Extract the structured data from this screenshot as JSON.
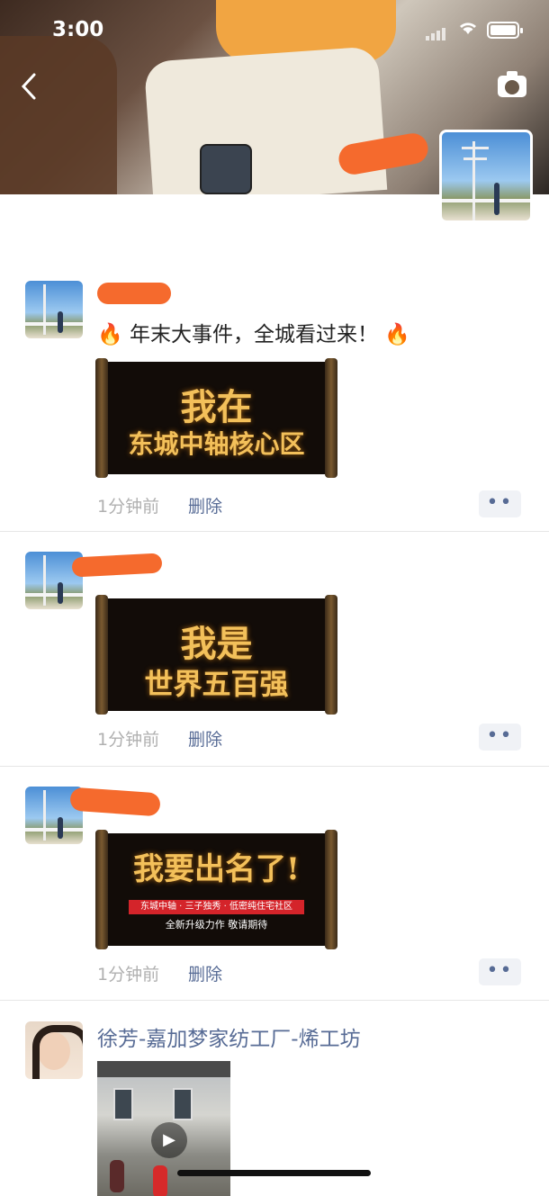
{
  "status_bar": {
    "time": "3:00"
  },
  "posts": [
    {
      "text": "年末大事件，全城看过来！",
      "emoji": "🔥",
      "poster_line1": "我在",
      "poster_line2": "东城中轴核心区",
      "time": "1分钟前",
      "delete_label": "删除"
    },
    {
      "poster_line1": "我是",
      "poster_line2": "世界五百强",
      "time": "1分钟前",
      "delete_label": "删除"
    },
    {
      "poster_line1": "我要出名了!",
      "poster_banner": "东城中轴 · 三子独秀 · 低密纯住宅社区",
      "poster_line3": "全新升级力作 敬请期待",
      "time": "1分钟前",
      "delete_label": "删除"
    },
    {
      "author": "徐芳-嘉加梦家纺工厂-烯工坊"
    }
  ],
  "icons": {
    "back": "chevron-left-icon",
    "camera": "camera-icon",
    "more": "more-dots-icon",
    "play": "play-icon"
  },
  "colors": {
    "link": "#576b95",
    "meta": "#b0b0b0",
    "redaction": "#f56a2d"
  }
}
